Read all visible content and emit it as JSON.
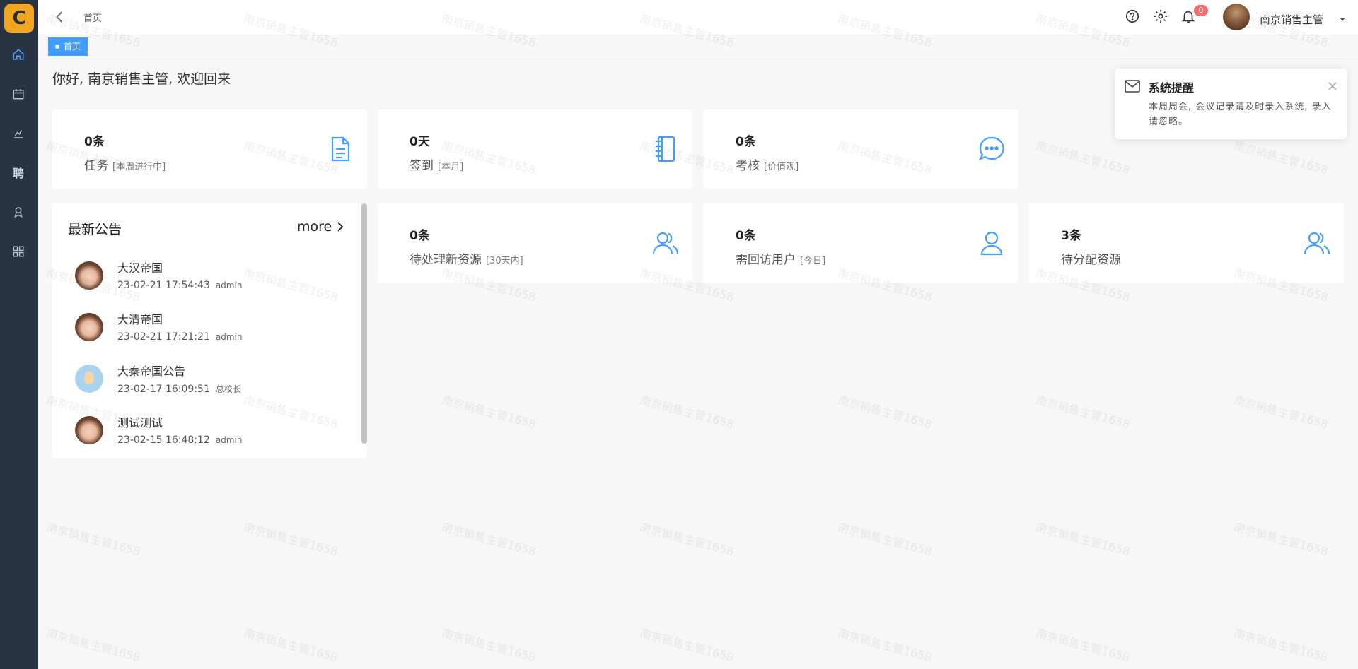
{
  "sidebar": {
    "logo_text": "C",
    "text_icon": "聘",
    "items": [
      {
        "name": "home-icon",
        "active": true
      },
      {
        "name": "calendar-icon",
        "active": false
      },
      {
        "name": "stats-icon",
        "active": false
      },
      {
        "name": "recruit-icon",
        "active": false
      },
      {
        "name": "award-icon",
        "active": false
      },
      {
        "name": "apps-icon",
        "active": false
      }
    ]
  },
  "header": {
    "breadcrumb": "首页",
    "notification_count": "0",
    "username": "南京销售主管"
  },
  "tabs": [
    {
      "label": "首页",
      "active": true
    }
  ],
  "welcome": "你好, 南京销售主管, 欢迎回来",
  "stats": [
    {
      "value": "0条",
      "label": "任务",
      "sub": "[本周进行中]",
      "icon": "document-icon"
    },
    {
      "value": "0天",
      "label": "签到",
      "sub": "[本月]",
      "icon": "notebook-icon"
    },
    {
      "value": "0条",
      "label": "考核",
      "sub": "[价值观]",
      "icon": "chat-icon"
    },
    {
      "value": "0条",
      "label": "待处理新资源",
      "sub": "[30天内]",
      "icon": "users-icon"
    },
    {
      "value": "0条",
      "label": "需回访用户",
      "sub": "[今日]",
      "icon": "user-icon"
    },
    {
      "value": "3条",
      "label": "待分配资源",
      "sub": "",
      "icon": "users-icon"
    }
  ],
  "notices": {
    "title": "最新公告",
    "more": "more",
    "items": [
      {
        "title": "大汉帝国",
        "time": "23-02-21 17:54:43",
        "author": "admin",
        "avatar": "girl"
      },
      {
        "title": "大清帝国",
        "time": "23-02-21 17:21:21",
        "author": "admin",
        "avatar": "girl"
      },
      {
        "title": "大秦帝国公告",
        "time": "23-02-17 16:09:51",
        "author": "总校长",
        "avatar": "boy"
      },
      {
        "title": "测试测试",
        "time": "23-02-15 16:48:12",
        "author": "admin",
        "avatar": "girl"
      }
    ]
  },
  "popup": {
    "title": "系统提醒",
    "body": "本周周会, 会议记录请及时录入系统, 录入请忽略。"
  },
  "watermark": "南京销售主管1658",
  "colors": {
    "sidebar_bg": "#283444",
    "accent": "#409eff",
    "badge": "#f56c6c",
    "logo": "#f0a623"
  }
}
